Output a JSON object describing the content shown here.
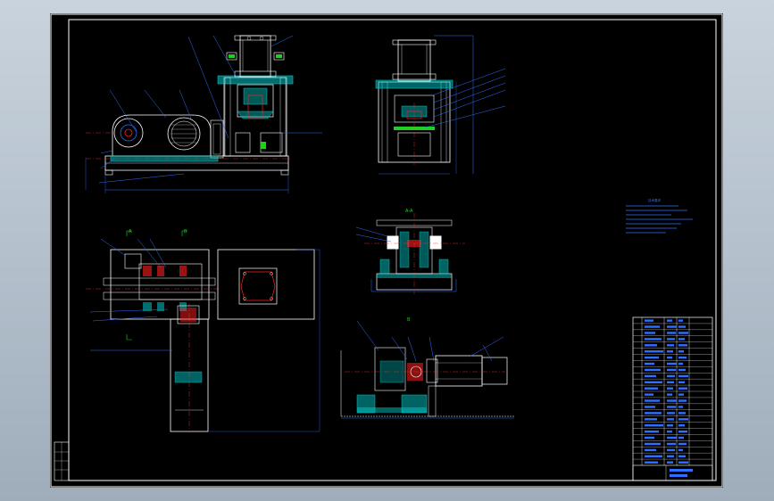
{
  "section_labels": {
    "view_a": "A",
    "view_b": "B",
    "section_aa": "A-A",
    "section_b": "B"
  },
  "tech_notes_title": "技术要求",
  "colors": {
    "background": "#000000",
    "frame": "#ffffff",
    "outline": "#ffffff",
    "leader": "#2e6fff",
    "hatch": "#00c8c8",
    "parts": "#ff2020",
    "centerline": "#ff3030",
    "tag": "#20d020"
  }
}
